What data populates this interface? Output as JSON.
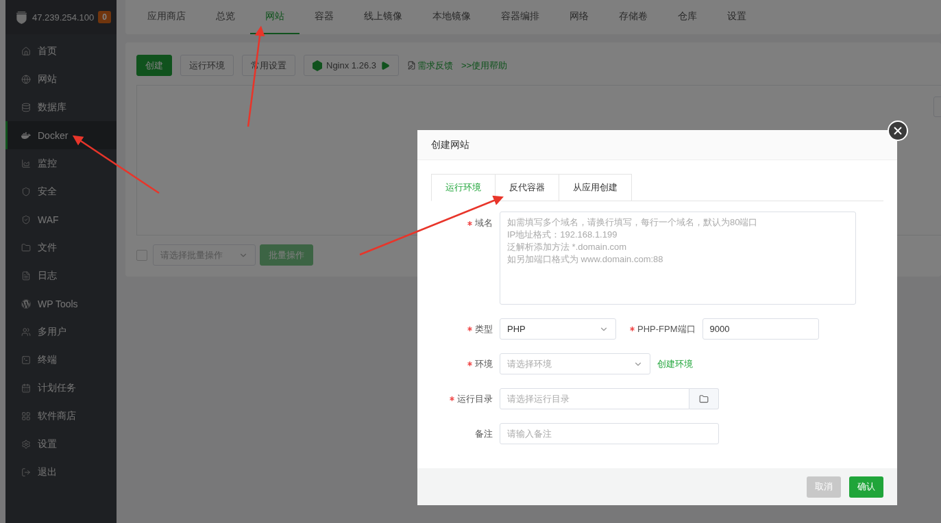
{
  "server": {
    "address": "47.239.254.100",
    "badge": "0"
  },
  "sidebar": {
    "items": [
      {
        "label": "首页",
        "selected": false
      },
      {
        "label": "网站",
        "selected": false
      },
      {
        "label": "数据库",
        "selected": false
      },
      {
        "label": "Docker",
        "selected": true
      },
      {
        "label": "监控",
        "selected": false
      },
      {
        "label": "安全",
        "selected": false
      },
      {
        "label": "WAF",
        "selected": false
      },
      {
        "label": "文件",
        "selected": false
      },
      {
        "label": "日志",
        "selected": false
      },
      {
        "label": "WP Tools",
        "selected": false
      },
      {
        "label": "多用户",
        "selected": false
      },
      {
        "label": "终端",
        "selected": false
      },
      {
        "label": "计划任务",
        "selected": false
      },
      {
        "label": "软件商店",
        "selected": false
      },
      {
        "label": "设置",
        "selected": false
      },
      {
        "label": "退出",
        "selected": false
      }
    ]
  },
  "top_tabs": [
    {
      "label": "应用商店",
      "selected": false
    },
    {
      "label": "总览",
      "selected": false
    },
    {
      "label": "网站",
      "selected": true
    },
    {
      "label": "容器",
      "selected": false
    },
    {
      "label": "线上镜像",
      "selected": false
    },
    {
      "label": "本地镜像",
      "selected": false
    },
    {
      "label": "容器编排",
      "selected": false
    },
    {
      "label": "网络",
      "selected": false
    },
    {
      "label": "存储卷",
      "selected": false
    },
    {
      "label": "仓库",
      "selected": false
    },
    {
      "label": "设置",
      "selected": false
    }
  ],
  "toolbar": {
    "create": "创建",
    "runtime": "运行环境",
    "settings": "常用设置",
    "nginx": "Nginx 1.26.3",
    "feedback": "需求反馈",
    "help": ">>使用帮助"
  },
  "batch": {
    "checked": false,
    "placeholder": "请选择批量操作",
    "button": "批量操作",
    "disabled": true
  },
  "dialog": {
    "title": "创建网站",
    "tabs": [
      {
        "label": "运行环境",
        "selected": true
      },
      {
        "label": "反代容器",
        "selected": false
      },
      {
        "label": "从应用创建",
        "selected": false
      }
    ],
    "fields": [
      {
        "kind": "textarea",
        "label": "域名",
        "required": true,
        "placeholder": "如需填写多个域名，请换行填写，每行一个域名，默认为80端口\nIP地址格式：192.168.1.199\n泛解析添加方法 *.domain.com\n如另加端口格式为 www.domain.com:88"
      },
      {
        "kind": "select",
        "label": "类型",
        "required": true,
        "value": "PHP",
        "extra": {
          "label": "PHP-FPM端口",
          "required": true,
          "value": "9000"
        }
      },
      {
        "kind": "select",
        "label": "环境",
        "required": true,
        "placeholder": "请选择环境",
        "link": "创建环境"
      },
      {
        "kind": "path",
        "label": "运行目录",
        "required": true,
        "placeholder": "请选择运行目录"
      },
      {
        "kind": "input",
        "label": "备注",
        "required": false,
        "placeholder": "请输入备注"
      }
    ],
    "cancel": "取消",
    "confirm": "确认"
  }
}
